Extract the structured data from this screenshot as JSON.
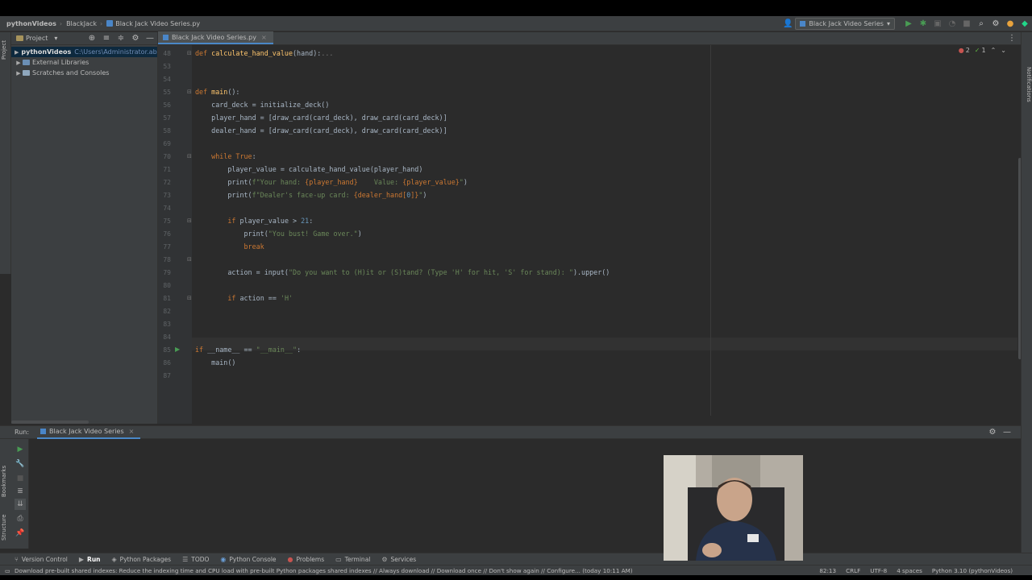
{
  "titlebar": {
    "project": "pythonVideos",
    "folder": "BlackJack",
    "file": "Black Jack Video Series.py",
    "run_config": "Black Jack Video Series"
  },
  "project_panel": {
    "title": "Project",
    "vertical_label": "Project",
    "items": [
      {
        "label": "pythonVideos",
        "path": "C:\\Users\\Administrator.abo"
      },
      {
        "label": "External Libraries",
        "path": ""
      },
      {
        "label": "Scratches and Consoles",
        "path": ""
      }
    ]
  },
  "editor": {
    "tab": "Black Jack Video Series.py",
    "inspection_errors": "2",
    "inspection_warnings": "1",
    "line_numbers": [
      "48",
      "53",
      "54",
      "55",
      "56",
      "57",
      "58",
      "69",
      "70",
      "71",
      "72",
      "73",
      "74",
      "75",
      "76",
      "77",
      "78",
      "79",
      "80",
      "81",
      "82",
      "83",
      "84",
      "85",
      "86",
      "87"
    ],
    "lines": [
      [
        "def ",
        "calculate_hand_value",
        "(hand):",
        "..."
      ],
      [],
      [],
      [
        "def ",
        "main",
        "():"
      ],
      [
        "    card_deck = initialize_deck()"
      ],
      [
        "    player_hand = [draw_card(card_deck), draw_card(card_deck)]"
      ],
      [
        "    dealer_hand = [draw_card(card_deck), draw_card(card_deck)]"
      ],
      [],
      [
        "    ",
        "while True",
        ":"
      ],
      [
        "        player_value = calculate_hand_value(player_hand)"
      ],
      [
        "        print(",
        "f\"Your hand: ",
        "{player_hand}",
        "    Value: ",
        "{player_value}",
        "\"",
        ")"
      ],
      [
        "        print(",
        "f\"Dealer's face-up card: ",
        "{dealer_hand[",
        "0",
        "]}",
        "\"",
        ")"
      ],
      [],
      [
        "        ",
        "if ",
        "player_value > ",
        "21",
        ":"
      ],
      [
        "            print(",
        "\"You bust! Game over.\"",
        ")"
      ],
      [
        "            ",
        "break"
      ],
      [],
      [
        "        action = input(",
        "\"Do you want to (H)it or (S)tand? (Type 'H' for hit, 'S' for stand): \"",
        ").upper()"
      ],
      [],
      [
        "        ",
        "if ",
        "action == ",
        "'H'"
      ],
      [],
      [],
      [],
      [
        "if ",
        "__name__ == ",
        "\"__main__\"",
        ":"
      ],
      [
        "    main()"
      ],
      []
    ]
  },
  "run_panel": {
    "label": "Run:",
    "tab": "Black Jack Video Series"
  },
  "tool_tabs": [
    "Version Control",
    "Run",
    "Python Packages",
    "TODO",
    "Python Console",
    "Problems",
    "Terminal",
    "Services"
  ],
  "status": {
    "message": "Download pre-built shared indexes: Reduce the indexing time and CPU load with pre-built Python packages shared indexes // Always download // Download once // Don't show again // Configure... (today 10:11 AM)",
    "position": "82:13",
    "line_sep": "CRLF",
    "encoding": "UTF-8",
    "indent": "4 spaces",
    "interpreter": "Python 3.10 (pythonVideos)"
  },
  "right_strip_label": "Notifications",
  "left_strip_labels": [
    "Bookmarks",
    "Structure"
  ]
}
